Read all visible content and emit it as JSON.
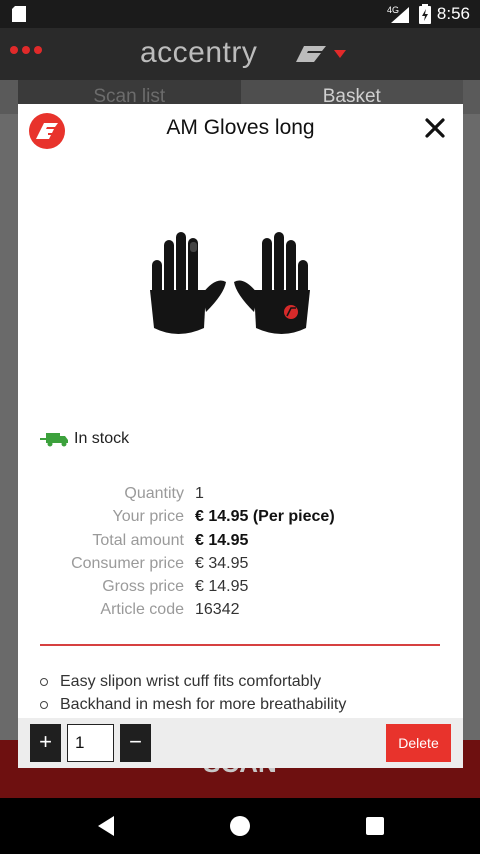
{
  "status_bar": {
    "network": "4G",
    "time": "8:56"
  },
  "header": {
    "brand": "accentry"
  },
  "tabs": [
    {
      "label": "Scan list"
    },
    {
      "label": "Basket"
    }
  ],
  "scan_button": {
    "label": "SCAN"
  },
  "modal": {
    "title": "AM Gloves long",
    "stock_status": "In stock",
    "details": [
      {
        "label": "Quantity",
        "value": "1"
      },
      {
        "label": "Your price",
        "value": "€ 14.95 (Per piece)"
      },
      {
        "label": "Total amount",
        "value": "€ 14.95"
      },
      {
        "label": "Consumer price",
        "value": "€ 34.95"
      },
      {
        "label": "Gross price",
        "value": "€ 14.95"
      },
      {
        "label": "Article code",
        "value": "16342"
      }
    ],
    "features": [
      "Easy slipon wrist cuff fits comfortably",
      "Backhand in mesh for more breathability"
    ],
    "quantity": {
      "plus_label": "+",
      "value": "1",
      "minus_label": "−"
    },
    "delete_label": "Delete"
  },
  "colors": {
    "accent": "#e8332c",
    "divider": "#d64040",
    "stock_green": "#3ca13c"
  },
  "icons": {
    "brand_logo": "hp-logo-icon",
    "close": "close-icon",
    "stock": "truck-icon",
    "menu": "menu-dots-icon"
  }
}
